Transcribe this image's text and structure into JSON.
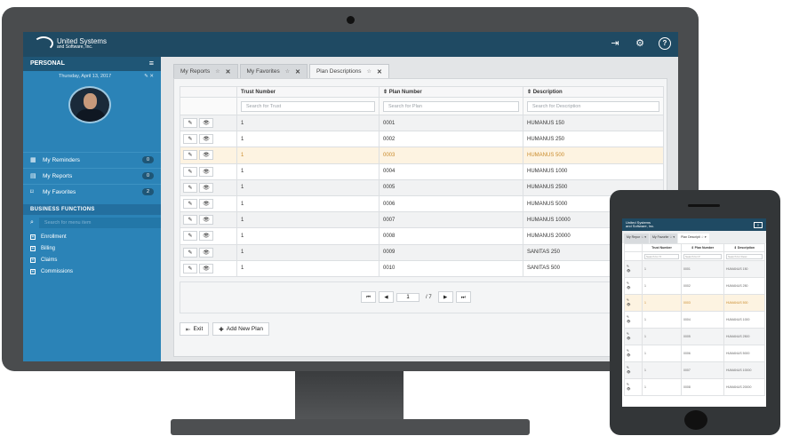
{
  "brand": {
    "name": "United Systems",
    "tagline": "and Software, Inc."
  },
  "topbar": {
    "icons": [
      "sign-out-icon",
      "gear-icon",
      "help-icon"
    ],
    "help_glyph": "?"
  },
  "sidebar": {
    "section_title": "PERSONAL",
    "date": "Thursday, April 13, 2017",
    "items": [
      {
        "label": "My Reminders",
        "count": "0",
        "icon": "calendar-icon"
      },
      {
        "label": "My Reports",
        "count": "0",
        "icon": "report-icon"
      },
      {
        "label": "My Favorites",
        "count": "2",
        "icon": "bookmark-icon"
      }
    ],
    "business_title": "BUSINESS FUNCTIONS",
    "search_placeholder": "Search for menu item",
    "functions": [
      "Enrollment",
      "Billing",
      "Claims",
      "Commissions"
    ]
  },
  "tabs": [
    {
      "label": "My Reports",
      "active": false
    },
    {
      "label": "My Favorites",
      "active": false
    },
    {
      "label": "Plan Descriptions",
      "active": true
    }
  ],
  "table": {
    "columns": [
      "Trust Number",
      "Plan Number",
      "Description"
    ],
    "search_placeholders": [
      "Search for Trust",
      "Search for Plan",
      "Search for Description"
    ],
    "rows": [
      [
        "1",
        "0001",
        "HUMANUS 150"
      ],
      [
        "1",
        "0002",
        "HUMANUS 250"
      ],
      [
        "1",
        "0003",
        "HUMANUS 500"
      ],
      [
        "1",
        "0004",
        "HUMANUS 1000"
      ],
      [
        "1",
        "0005",
        "HUMANUS 2500"
      ],
      [
        "1",
        "0006",
        "HUMANUS 5000"
      ],
      [
        "1",
        "0007",
        "HUMANUS 10000"
      ],
      [
        "1",
        "0008",
        "HUMANUS 20000"
      ],
      [
        "1",
        "0009",
        "SANITAS 250"
      ],
      [
        "1",
        "0010",
        "SANITAS 500"
      ]
    ],
    "highlighted_row": 3
  },
  "pager": {
    "page": "1",
    "of_label": "/ 7"
  },
  "buttons": {
    "exit": "Exit",
    "add": "Add New Plan"
  },
  "mobile": {
    "brand": "United Systems",
    "brand_tagline": "and Software, Inc.",
    "tabs": [
      "My Repor",
      "My Favorite",
      "Plan Descripti"
    ],
    "columns": [
      "Trust Number",
      "Plan Number",
      "Description"
    ],
    "search_placeholders": [
      "Search for Tr",
      "Search for P",
      "Search for Desc"
    ],
    "rows": [
      [
        "1",
        "0001",
        "HUMANUS 150"
      ],
      [
        "1",
        "0002",
        "HUMANUS 250"
      ],
      [
        "1",
        "0003",
        "HUMANUS 500"
      ],
      [
        "1",
        "0004",
        "HUMANUS 1000"
      ],
      [
        "1",
        "0005",
        "HUMANUS 2500"
      ],
      [
        "1",
        "0006",
        "HUMANUS 5000"
      ],
      [
        "1",
        "0007",
        "HUMANUS 10000"
      ],
      [
        "1",
        "0008",
        "HUMANUS 20000"
      ]
    ]
  },
  "colors": {
    "header": "#1f4a63",
    "sidebar": "#2b83b7",
    "highlight_row": "#fdf3e1"
  }
}
